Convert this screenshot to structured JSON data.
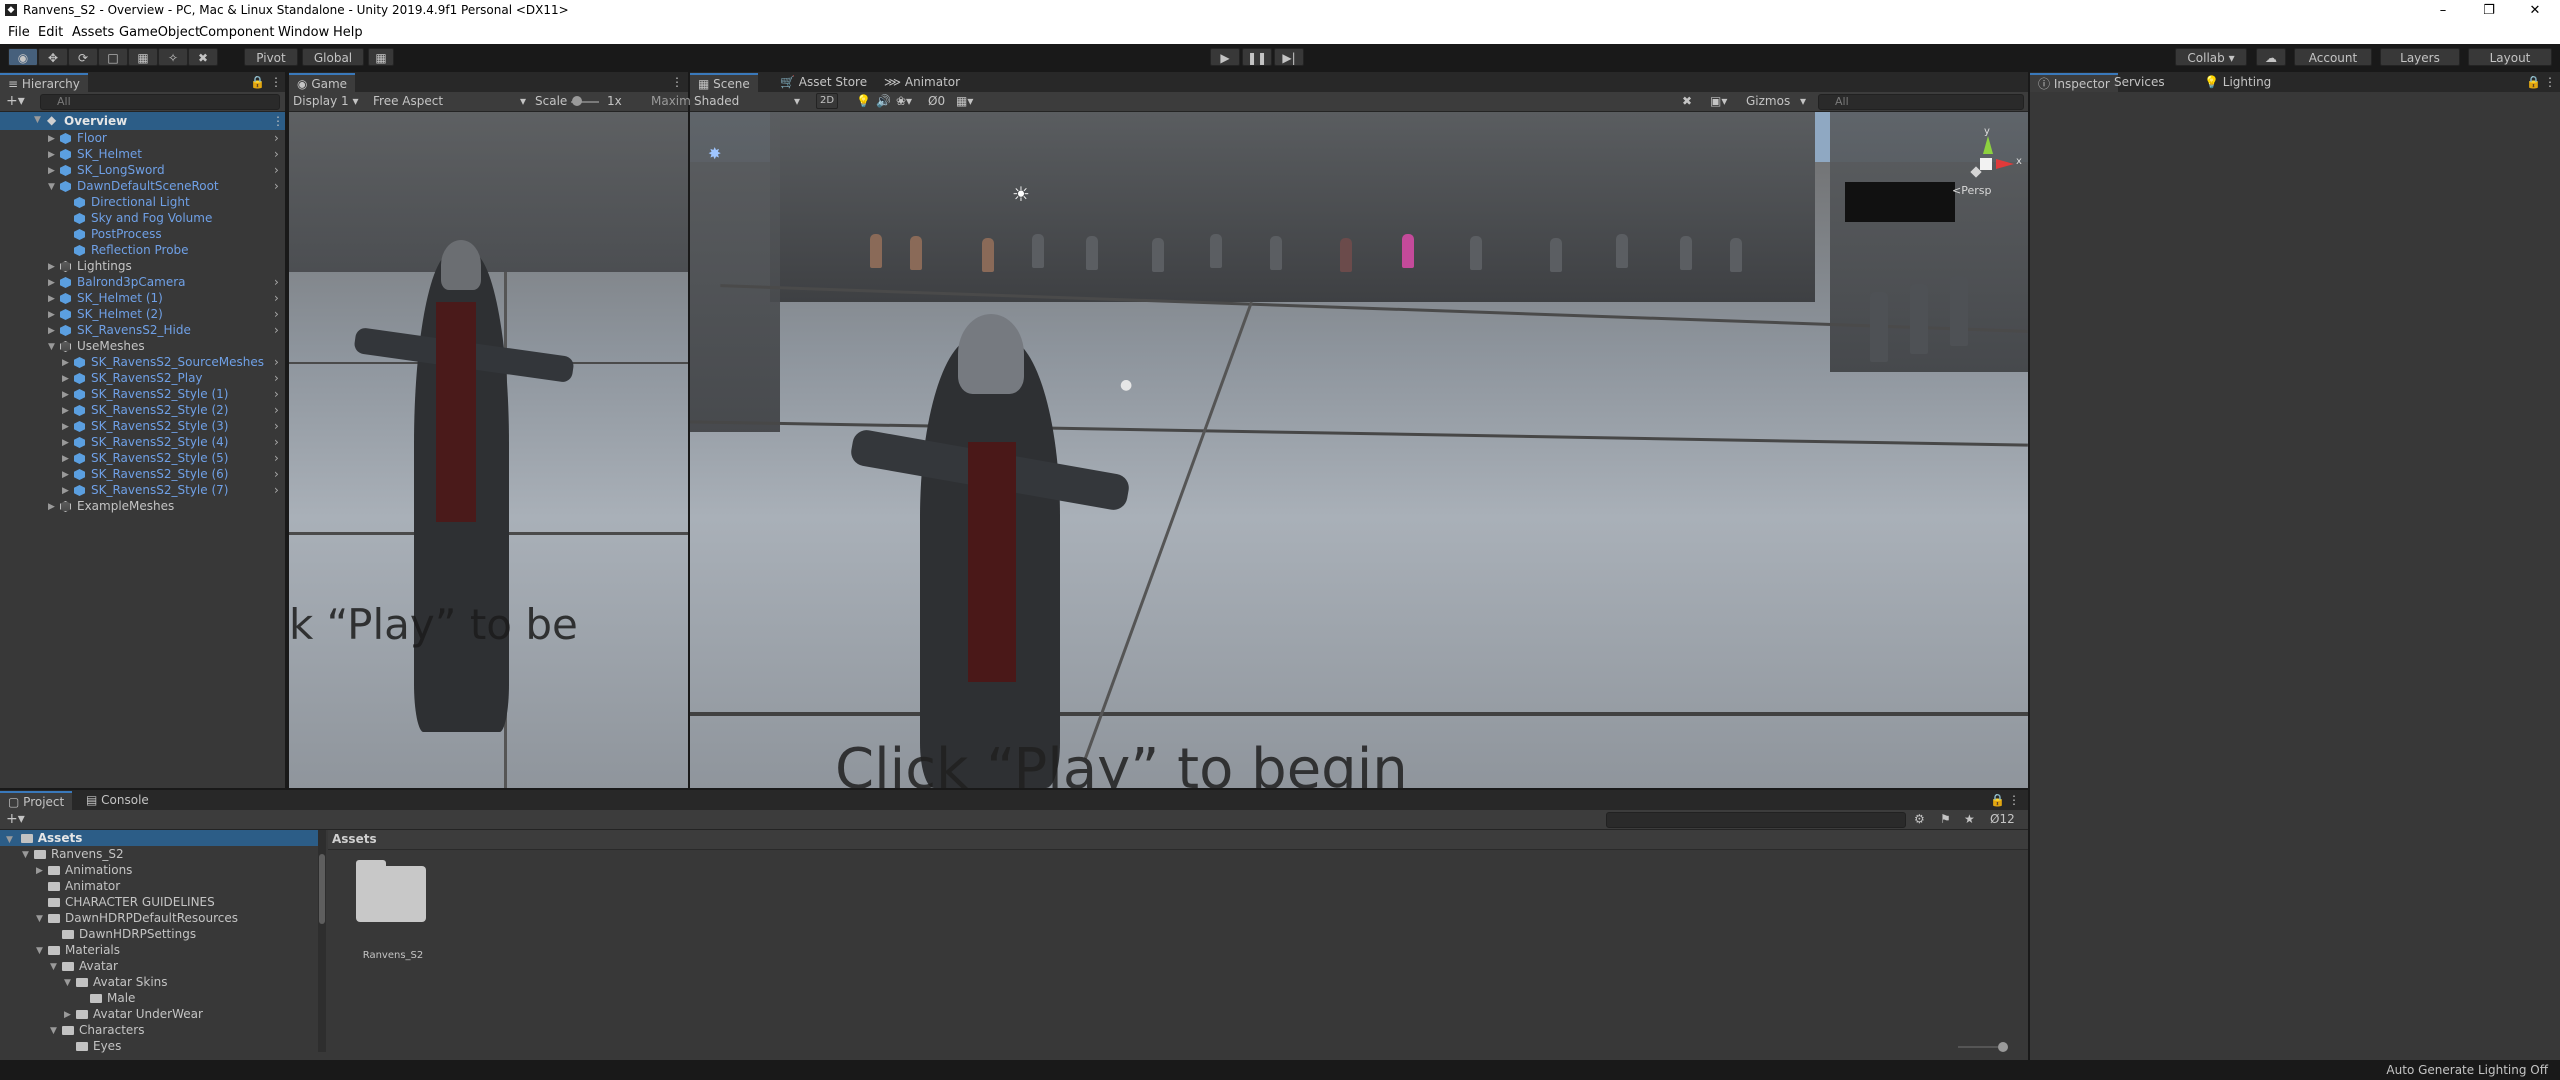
{
  "window": {
    "title": "Ranvens_S2 - Overview - PC, Mac & Linux Standalone - Unity 2019.4.9f1 Personal <DX11>",
    "logo": "unity-icon"
  },
  "menus": [
    "File",
    "Edit",
    "Assets",
    "GameObject",
    "Component",
    "Window",
    "Help"
  ],
  "toolbar": {
    "pivot": "Pivot",
    "global": "Global",
    "collab": "Collab ▾",
    "account": "Account",
    "layers": "Layers",
    "layout": "Layout"
  },
  "hierarchy": {
    "tab": "Hierarchy",
    "search_placeholder": "All",
    "scene": "Overview",
    "items": [
      {
        "label": "Floor",
        "depth": 1,
        "color": "blue",
        "expand": "collapsed"
      },
      {
        "label": "SK_Helmet",
        "depth": 1,
        "color": "blue",
        "expand": "collapsed"
      },
      {
        "label": "SK_LongSword",
        "depth": 1,
        "color": "blue",
        "expand": "collapsed"
      },
      {
        "label": "DawnDefaultSceneRoot",
        "depth": 1,
        "color": "blue",
        "expand": "expanded"
      },
      {
        "label": "Directional Light",
        "depth": 2,
        "color": "blue",
        "expand": "none"
      },
      {
        "label": "Sky and Fog Volume",
        "depth": 2,
        "color": "blue",
        "expand": "none"
      },
      {
        "label": "PostProcess",
        "depth": 2,
        "color": "blue",
        "expand": "none"
      },
      {
        "label": "Reflection Probe",
        "depth": 2,
        "color": "blue",
        "expand": "none"
      },
      {
        "label": "Lightings",
        "depth": 1,
        "color": "gray",
        "expand": "collapsed"
      },
      {
        "label": "Balrond3pCamera",
        "depth": 1,
        "color": "blue",
        "expand": "collapsed"
      },
      {
        "label": "SK_Helmet (1)",
        "depth": 1,
        "color": "blue",
        "expand": "collapsed"
      },
      {
        "label": "SK_Helmet (2)",
        "depth": 1,
        "color": "blue",
        "expand": "collapsed"
      },
      {
        "label": "SK_RavensS2_Hide",
        "depth": 1,
        "color": "blue",
        "expand": "collapsed"
      },
      {
        "label": "UseMeshes",
        "depth": 1,
        "color": "gray",
        "expand": "expanded"
      },
      {
        "label": "SK_RavensS2_SourceMeshes",
        "depth": 2,
        "color": "blue",
        "expand": "collapsed"
      },
      {
        "label": "SK_RavensS2_Play",
        "depth": 2,
        "color": "blue",
        "expand": "collapsed"
      },
      {
        "label": "SK_RavensS2_Style (1)",
        "depth": 2,
        "color": "blue",
        "expand": "collapsed"
      },
      {
        "label": "SK_RavensS2_Style (2)",
        "depth": 2,
        "color": "blue",
        "expand": "collapsed"
      },
      {
        "label": "SK_RavensS2_Style (3)",
        "depth": 2,
        "color": "blue",
        "expand": "collapsed"
      },
      {
        "label": "SK_RavensS2_Style (4)",
        "depth": 2,
        "color": "blue",
        "expand": "collapsed"
      },
      {
        "label": "SK_RavensS2_Style (5)",
        "depth": 2,
        "color": "blue",
        "expand": "collapsed"
      },
      {
        "label": "SK_RavensS2_Style (6)",
        "depth": 2,
        "color": "blue",
        "expand": "collapsed"
      },
      {
        "label": "SK_RavensS2_Style (7)",
        "depth": 2,
        "color": "blue",
        "expand": "collapsed"
      },
      {
        "label": "ExampleMeshes",
        "depth": 1,
        "color": "gray",
        "expand": "collapsed"
      }
    ]
  },
  "game": {
    "tab": "Game",
    "display": "Display 1",
    "aspect": "Free Aspect",
    "scale_label": "Scale",
    "scale_value": "1x",
    "maximize": "Maxim",
    "overlay_text": "k “Play” to be"
  },
  "scene": {
    "tab": "Scene",
    "shading": "Shaded",
    "mode_2d": "2D",
    "hidden_count": "0",
    "gizmos": "Gizmos",
    "search_placeholder": "All",
    "persp": "<Persp",
    "overlay_text": "Click “Play” to begin",
    "gizmo_axes": {
      "y": "y",
      "x": "x"
    }
  },
  "tabs_center": {
    "asset_store": "Asset Store",
    "animator": "Animator"
  },
  "inspector_tabs": {
    "inspector": "Inspector",
    "services": "Services",
    "lighting": "Lighting"
  },
  "project": {
    "tab": "Project",
    "console_tab": "Console",
    "tree_root": "Assets",
    "tree": [
      {
        "label": "Ranvens_S2",
        "depth": 1,
        "expand": "expanded"
      },
      {
        "label": "Animations",
        "depth": 2,
        "expand": "collapsed"
      },
      {
        "label": "Animator",
        "depth": 2,
        "expand": "none"
      },
      {
        "label": "CHARACTER GUIDELINES",
        "depth": 2,
        "expand": "none"
      },
      {
        "label": "DawnHDRPDefaultResources",
        "depth": 2,
        "expand": "expanded"
      },
      {
        "label": "DawnHDRPSettings",
        "depth": 3,
        "expand": "none"
      },
      {
        "label": "Materials",
        "depth": 2,
        "expand": "expanded"
      },
      {
        "label": "Avatar",
        "depth": 3,
        "expand": "expanded"
      },
      {
        "label": "Avatar Skins",
        "depth": 4,
        "expand": "expanded"
      },
      {
        "label": "Male",
        "depth": 5,
        "expand": "none"
      },
      {
        "label": "Avatar UnderWear",
        "depth": 4,
        "expand": "collapsed"
      },
      {
        "label": "Characters",
        "depth": 3,
        "expand": "expanded"
      },
      {
        "label": "Eyes",
        "depth": 4,
        "expand": "none"
      }
    ],
    "breadcrumb": "Assets",
    "folder_name": "Ranvens_S2",
    "hidden_count": "12"
  },
  "status": {
    "text": "Auto Generate Lighting Off"
  }
}
